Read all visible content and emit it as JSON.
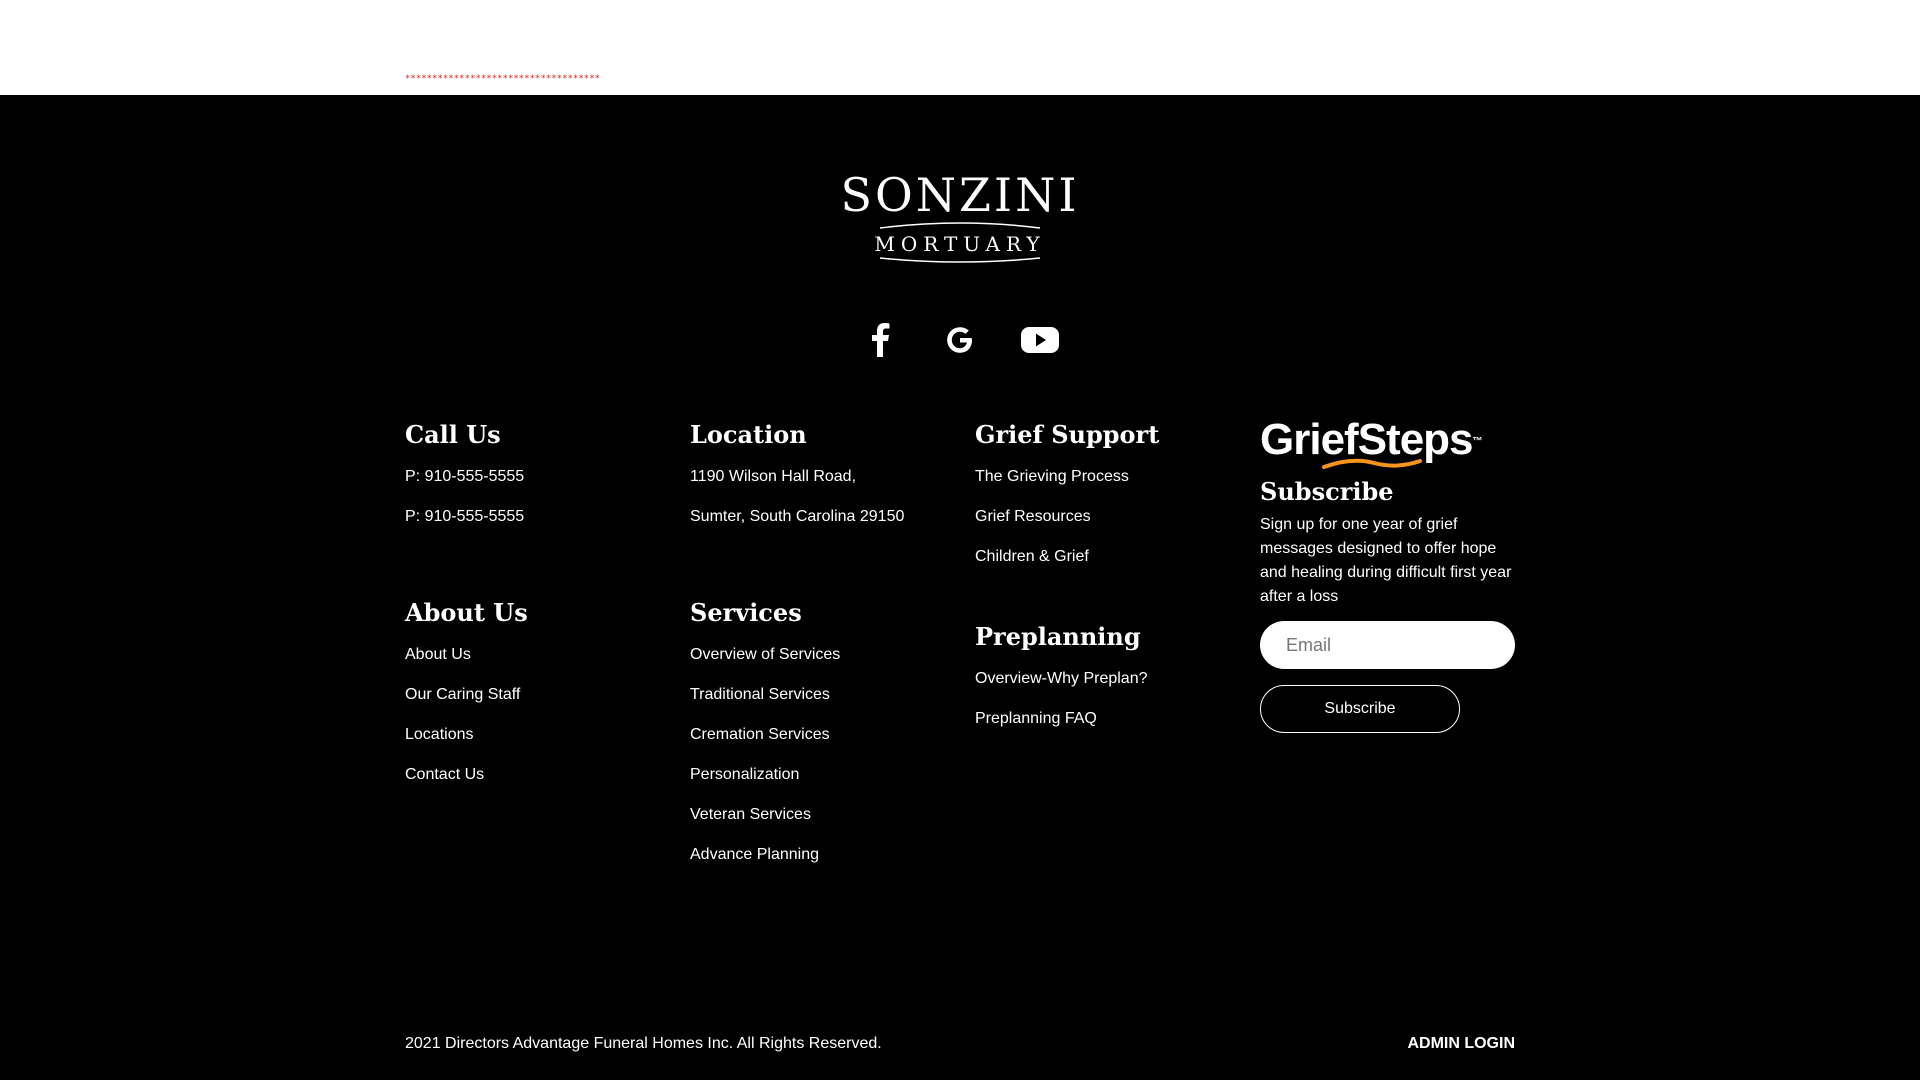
{
  "top": {
    "dots": "************************************"
  },
  "logo": {
    "main": "SONZINI",
    "sub": "MORTUARY"
  },
  "social": {
    "icons": [
      "facebook-icon",
      "google-icon",
      "youtube-icon"
    ]
  },
  "call_us": {
    "heading": "Call Us",
    "items": [
      "P: 910-555-5555",
      "P: 910-555-5555"
    ]
  },
  "location": {
    "heading": "Location",
    "items": [
      "1190 Wilson Hall Road,",
      "Sumter, South Carolina 29150"
    ]
  },
  "grief_support": {
    "heading": "Grief Support",
    "items": [
      "The Grieving Process",
      "Grief Resources",
      "Children & Grief"
    ]
  },
  "about_us": {
    "heading": "About Us",
    "items": [
      "About Us",
      "Our Caring Staff",
      "Locations",
      "Contact Us"
    ]
  },
  "services": {
    "heading": "Services",
    "items": [
      "Overview of Services",
      "Traditional Services",
      "Cremation Services",
      "Personalization",
      "Veteran Services",
      "Advance Planning"
    ]
  },
  "preplanning": {
    "heading": "Preplanning",
    "items": [
      "Overview-Why Preplan?",
      "Preplanning FAQ"
    ]
  },
  "griefsteps": {
    "logo": "GriefSteps",
    "tm": "™",
    "title": "Subscribe",
    "desc": "Sign up for one year of grief messages designed to offer hope and healing during difficult first year after a loss",
    "email_placeholder": "Email",
    "button": "Subscribe",
    "accent": "#f7941d"
  },
  "footer": {
    "copyright": "2021 Directors Advantage Funeral Homes Inc. All Rights Reserved.",
    "admin": "ADMIN LOGIN"
  },
  "colors": {
    "background": "#000000",
    "text": "#ffffff",
    "dots": "#dd2222"
  }
}
